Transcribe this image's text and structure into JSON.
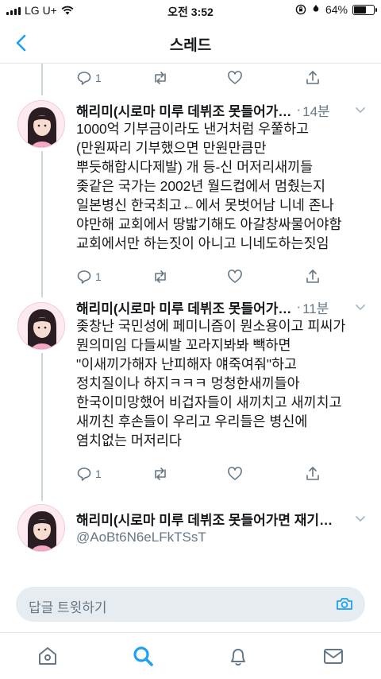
{
  "status_bar": {
    "carrier": "LG U+",
    "time": "오전 3:52",
    "battery": "64%",
    "battery_level": 0.64
  },
  "header": {
    "title": "스레드"
  },
  "prev_tweet_actions": {
    "replies": "1",
    "retweets": "",
    "likes": ""
  },
  "tweets": [
    {
      "name": "해리미(시로마 미루 데뷔조 못들어가…",
      "sep": "·",
      "time": "14분",
      "lines": [
        "1000억 기부금이라도 낸거처럼 우쭐하고",
        "(만원짜리 기부했으면 만원만큼만",
        "뿌듯해합시다제발) 개 등-신 머저리새끼들",
        "좆같은 국가는 2002년 월드컵에서 멈췄는지",
        "일본병신 한국최고←에서 못벗어남 니네 존나",
        "야만해 교회에서 땅밟기해도 아갈창싸물어야함",
        "교회에서만 하는짓이 아니고 니네도하는짓임"
      ],
      "replies": "1"
    },
    {
      "name": "해리미(시로마 미루 데뷔조 못들어가…",
      "sep": "·",
      "time": "11분",
      "lines": [
        "좆창난 국민성에 페미니즘이 뭔소용이고 피씨가",
        "뭔의미임 다들씨발 꼬라지봐봐 빽하면",
        "\"이새끼가해자 난피해자 얘죽여줘\"하고",
        "정치질이나 하지ㅋㅋㅋ 멍청한새끼들아",
        "한국이미망했어 비겁자들이 새끼치고 새끼치고",
        "새끼친 후손들이 우리고 우리들은 병신에",
        "염치없는 머저리다"
      ],
      "replies": "1"
    }
  ],
  "profile_preview": {
    "name": "해리미(시로마 미루 데뷔조 못들어가면 재기…",
    "handle": "@AoBt6N6eLFkTSsT"
  },
  "reply_box": {
    "placeholder": "답글 트윗하기"
  },
  "tab_bar": {
    "items": [
      "home-icon",
      "search-icon",
      "notifications-icon",
      "messages-icon"
    ],
    "active": "search-icon"
  },
  "colors": {
    "accent": "#1da1f2",
    "muted": "#657786",
    "thread_line": "#ccd6dd"
  }
}
